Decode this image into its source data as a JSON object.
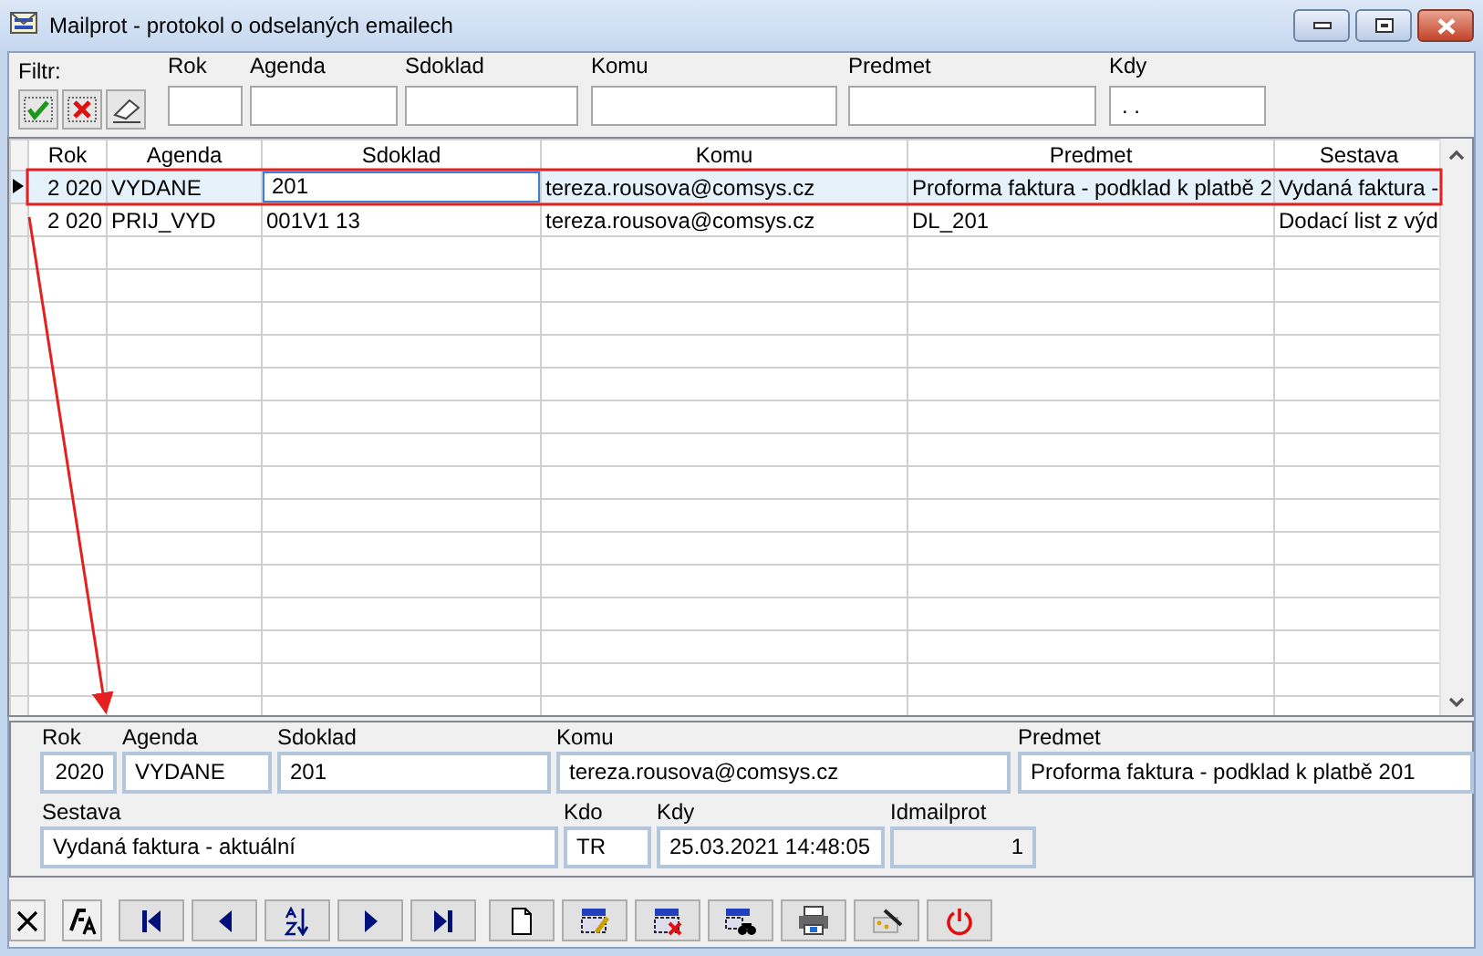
{
  "window": {
    "title": "Mailprot - protokol o odselaných emailech"
  },
  "filter": {
    "label": "Filtr:",
    "fields": [
      {
        "label": "Rok"
      },
      {
        "label": "Agenda"
      },
      {
        "label": "Sdoklad"
      },
      {
        "label": "Komu"
      },
      {
        "label": "Predmet"
      },
      {
        "label": "Kdy",
        "value": ". ."
      }
    ]
  },
  "grid": {
    "columns": [
      "Rok",
      "Agenda",
      "Sdoklad",
      "Komu",
      "Predmet",
      "Sestava"
    ],
    "rows": [
      {
        "selected": true,
        "cells": [
          {
            "text": "2 020",
            "editing": false
          },
          {
            "text": "VYDANE",
            "editing": false
          },
          {
            "text": "201",
            "editing": true
          },
          {
            "text": "tereza.rousova@comsys.cz",
            "editing": false
          },
          {
            "text": "Proforma faktura - podklad k platbě 2",
            "editing": false
          },
          {
            "text": "Vydaná faktura -",
            "editing": false
          }
        ]
      },
      {
        "selected": false,
        "cells": [
          {
            "text": "2 020",
            "editing": false
          },
          {
            "text": "PRIJ_VYD",
            "editing": false
          },
          {
            "text": "001V1   13",
            "editing": false
          },
          {
            "text": "tereza.rousova@comsys.cz",
            "editing": false
          },
          {
            "text": "DL_201",
            "editing": false
          },
          {
            "text": "Dodací list z výd",
            "editing": false
          }
        ]
      }
    ]
  },
  "detail": {
    "fields": [
      {
        "label": "Rok",
        "value": "2020",
        "kind": "number",
        "readonly": false
      },
      {
        "label": "Agenda",
        "value": "VYDANE",
        "kind": "text",
        "readonly": false
      },
      {
        "label": "Sdoklad",
        "value": "201",
        "kind": "text",
        "readonly": false
      },
      {
        "label": "Komu",
        "value": "tereza.rousova@comsys.cz",
        "kind": "text",
        "readonly": false
      },
      {
        "label": "Predmet",
        "value": "Proforma faktura - podklad k platbě 201",
        "kind": "text",
        "readonly": false
      },
      {
        "label": "Sestava",
        "value": "Vydaná faktura - aktuální",
        "kind": "text",
        "readonly": false
      },
      {
        "label": "Kdo",
        "value": "TR",
        "kind": "text",
        "readonly": false
      },
      {
        "label": "Kdy",
        "value": "25.03.2021 14:48:05",
        "kind": "text",
        "readonly": false
      },
      {
        "label": "Idmailprot",
        "value": "1",
        "kind": "number",
        "readonly": true
      }
    ]
  }
}
